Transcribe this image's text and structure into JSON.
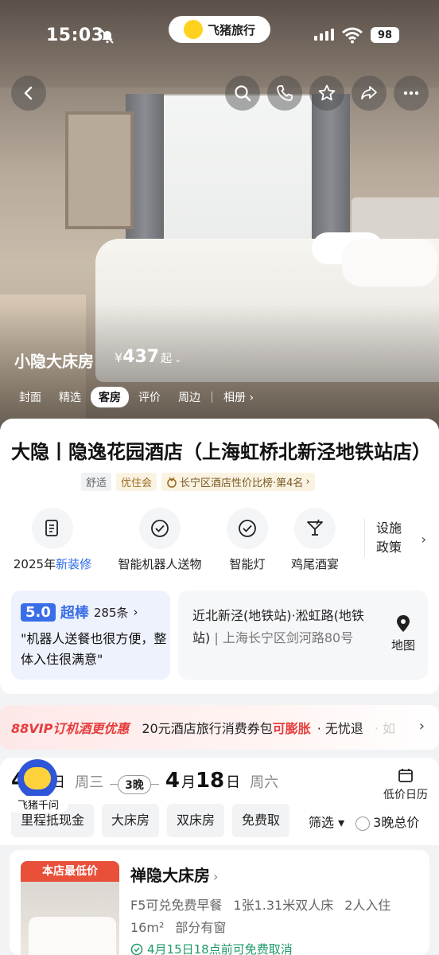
{
  "status_bar": {
    "time": "15:03",
    "app_pill": "飞猪旅行",
    "battery": "98"
  },
  "hero": {
    "room_name": "小隐大床房",
    "currency": "¥",
    "price": "437",
    "price_suffix": "起",
    "tabs": [
      {
        "label": "封面",
        "active": false
      },
      {
        "label": "精选",
        "active": false
      },
      {
        "label": "客房",
        "active": true
      },
      {
        "label": "评价",
        "active": false
      },
      {
        "label": "周边",
        "active": false
      },
      {
        "label": "相册",
        "active": false
      }
    ],
    "tab_more": "›"
  },
  "hotel": {
    "title": "大隐丨隐逸花园酒店（上海虹桥北新泾地铁站店）",
    "tags": [
      "舒适",
      "优住会"
    ],
    "rank_tag": "长宁区酒店性价比榜·第4名",
    "rank_chev": "›"
  },
  "features": [
    {
      "icon": "document-icon",
      "label_prefix": "2025年",
      "label_highlight": "新装修"
    },
    {
      "icon": "check-circle-icon",
      "label": "智能机器人送物"
    },
    {
      "icon": "check-circle-icon",
      "label": "智能灯"
    },
    {
      "icon": "cocktail-icon",
      "label": "鸡尾酒宴"
    }
  ],
  "facilities": {
    "line1": "设施",
    "line2": "政策",
    "arrow": "›"
  },
  "review": {
    "score": "5.0",
    "word": "超棒",
    "count": "285条",
    "chev": "›",
    "quote": "\"机器人送餐也很方便，整体入住很满意\""
  },
  "address": {
    "main": "近北新泾(地铁站)·淞虹路(地铁站)",
    "sep": "|",
    "detail": "上海长宁区剑河路80号",
    "map_label": "地图"
  },
  "vip_strip": {
    "title": "88VIP订机酒更优惠",
    "text1": "20元酒店旅行消费券包",
    "highlight": "可膨胀",
    "text2": "· 无忧退",
    "fade": "· 如",
    "arrow": "›"
  },
  "dates": {
    "checkin_month": "4",
    "checkin_unit": "日",
    "checkin_week": "周三",
    "nights": "3晚",
    "checkout_month": "4",
    "checkout_sep": "月",
    "checkout_day": "18",
    "checkout_unit": "日",
    "checkout_week": "周六",
    "calendar_label": "低价日历"
  },
  "mascot_label": "飞猪千问",
  "filters": {
    "chips": [
      "里程抵现金",
      "大床房",
      "双床房",
      "免费取"
    ],
    "sort_label": "筛选",
    "total_label": "3晚总价"
  },
  "room_card": {
    "badge": "本店最低价",
    "title": "禅隐大床房",
    "title_arrow": "›",
    "line1": [
      "F5可兑免费早餐",
      "1张1.31米双人床",
      "2人入住"
    ],
    "line2": [
      "16m²",
      "部分有窗"
    ],
    "cancel": "4月15日18点前可免费取消"
  },
  "colors": {
    "accent_blue": "#3a6ee8",
    "vip_red": "#e63d3d",
    "badge_orange": "#e8503a",
    "cancel_green": "#1e9a6a"
  }
}
